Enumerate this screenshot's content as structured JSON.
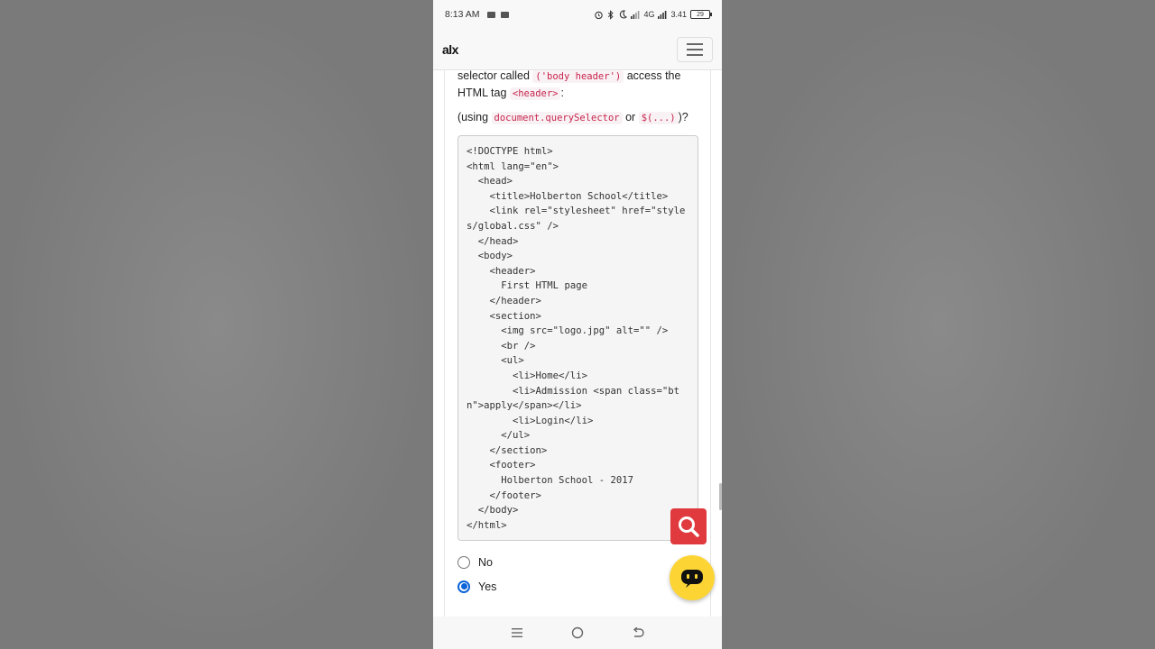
{
  "status_bar": {
    "time": "8:13 AM",
    "network": "4G",
    "speed": "3.41",
    "battery": "29"
  },
  "navbar": {
    "logo": "alx"
  },
  "question": {
    "line1_prefix": "selector called",
    "line1_code": "('body header')",
    "line1_suffix": "access the HTML tag",
    "line1_tag": "<header>",
    "line1_end": ":",
    "line2_prefix": "(using",
    "line2_code1": "document.querySelector",
    "line2_mid": "or",
    "line2_code2": "$(...)",
    "line2_end": ")?"
  },
  "code_block": "<!DOCTYPE html>\n<html lang=\"en\">\n  <head>\n    <title>Holberton School</title>\n    <link rel=\"stylesheet\" href=\"styles/global.css\" />\n  </head>\n  <body>\n    <header>\n      First HTML page\n    </header>\n    <section>\n      <img src=\"logo.jpg\" alt=\"\" />\n      <br />\n      <ul>\n        <li>Home</li>\n        <li>Admission <span class=\"btn\">apply</span></li>\n        <li>Login</li>\n      </ul>\n    </section>\n    <footer>\n      Holberton School - 2017\n    </footer>\n  </body>\n</html>",
  "answers": [
    {
      "label": "No",
      "checked": false
    },
    {
      "label": "Yes",
      "checked": true
    }
  ],
  "colors": {
    "accent": "#0b63d8",
    "code_text": "#c7254e",
    "search_fab": "#e0393e",
    "chat_fab": "#fcd535"
  },
  "icons": {
    "search_fab": "search-icon",
    "chat_fab": "chat-bot-icon"
  }
}
